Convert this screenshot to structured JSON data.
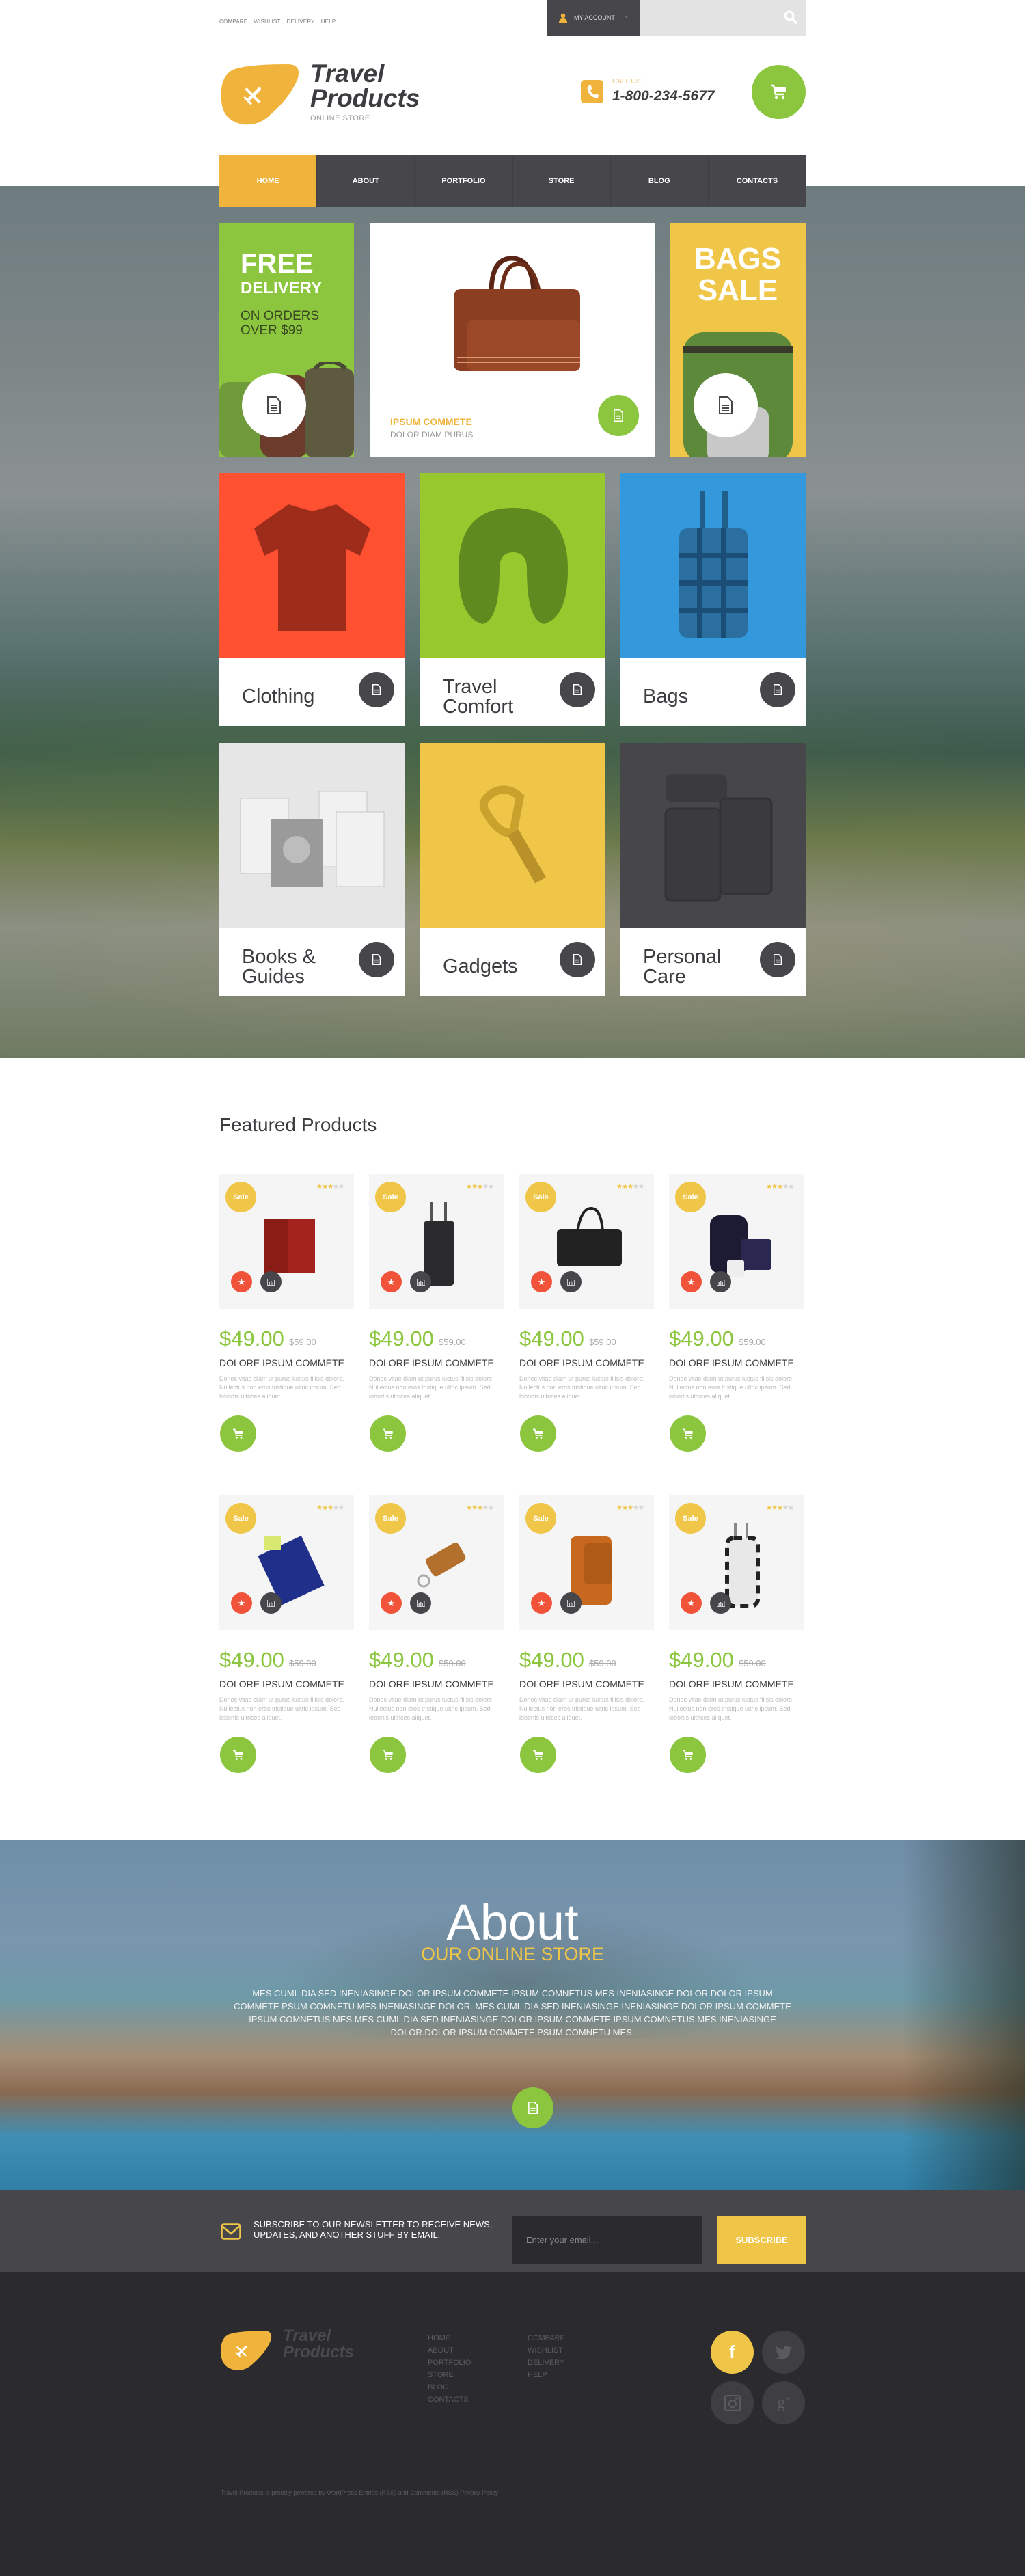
{
  "top_links": [
    "COMPARE",
    "WISHLIST",
    "DELIVERY",
    "HELP"
  ],
  "account": {
    "label": "MY ACCOUNT",
    "icon": "user-icon"
  },
  "search": {
    "placeholder": "",
    "icon": "search-icon"
  },
  "logo": {
    "line1": "Travel",
    "line2": "Products",
    "subtitle": "ONLINE STORE",
    "icon": "airplane-icon"
  },
  "contact": {
    "label": "CALL US:",
    "phone": "1-800-234-5677",
    "icon": "phone-icon"
  },
  "cart": {
    "icon": "cart-icon"
  },
  "nav": [
    {
      "label": "HOME",
      "active": true
    },
    {
      "label": "ABOUT"
    },
    {
      "label": "PORTFOLIO"
    },
    {
      "label": "STORE"
    },
    {
      "label": "BLOG"
    },
    {
      "label": "CONTACTS"
    }
  ],
  "promos": {
    "free_delivery": {
      "line1": "FREE",
      "line2": "DELIVERY",
      "line3": "ON ORDERS OVER $99"
    },
    "featured": {
      "title": "IPSUM COMMETE",
      "subtitle": "DOLOR DIAM PURUS"
    },
    "bags_sale": {
      "line1": "BAGS",
      "line2": "SALE"
    }
  },
  "categories": [
    {
      "label": "Clothing",
      "color": "#ff5132"
    },
    {
      "label": "Travel Comfort",
      "color": "#97c92e"
    },
    {
      "label": "Bags",
      "color": "#3498dc"
    },
    {
      "label": "Books & Guides",
      "color": "#e6e6e6"
    },
    {
      "label": "Gadgets",
      "color": "#f0c648"
    },
    {
      "label": "Personal Care",
      "color": "#47464b"
    }
  ],
  "featured": {
    "title": "Featured Products",
    "products": [
      {
        "badge": "Sale",
        "rating": 3,
        "price": "$49.00",
        "old_price": "$59.00",
        "name": "DOLORE IPSUM COMMETE",
        "desc": "Donec vitae diam ut purus luctus filisis dolore. Nullectus non eros tristique ultric ipsum. Sed lobortis ultrices aliquet.",
        "item": "red wallet"
      },
      {
        "badge": "Sale",
        "rating": 3,
        "price": "$49.00",
        "old_price": "$59.00",
        "name": "DOLORE IPSUM COMMETE",
        "desc": "Donec vitae diam ut purus luctus filisis dolore. Nullectus non eros tristique ultric ipsum. Sed lobortis ultrices aliquet.",
        "item": "black rolling suitcase"
      },
      {
        "badge": "Sale",
        "rating": 3,
        "price": "$49.00",
        "old_price": "$59.00",
        "name": "DOLORE IPSUM COMMETE",
        "desc": "Donec vitae diam ut purus luctus filisis dolore. Nullectus non eros tristique ultric ipsum. Sed lobortis ultrices aliquet.",
        "item": "black travel bag"
      },
      {
        "badge": "Sale",
        "rating": 3,
        "price": "$49.00",
        "old_price": "$59.00",
        "name": "DOLORE IPSUM COMMETE",
        "desc": "Donec vitae diam ut purus luctus filisis dolore. Nullectus non eros tristique ultric ipsum. Sed lobortis ultrices aliquet.",
        "item": "backpack set"
      },
      {
        "badge": "Sale",
        "rating": 3,
        "price": "$49.00",
        "old_price": "$59.00",
        "name": "DOLORE IPSUM COMMETE",
        "desc": "Donec vitae diam ut purus luctus filisis dolore. Nullectus non eros tristique ultric ipsum. Sed lobortis ultrices aliquet.",
        "item": "blue travel organizer"
      },
      {
        "badge": "Sale",
        "rating": 3,
        "price": "$49.00",
        "old_price": "$59.00",
        "name": "DOLORE IPSUM COMMETE",
        "desc": "Donec vitae diam ut purus luctus filisis dolore. Nullectus non eros tristique ultric ipsum. Sed lobortis ultrices aliquet.",
        "item": "key holder"
      },
      {
        "badge": "Sale",
        "rating": 3,
        "price": "$49.00",
        "old_price": "$59.00",
        "name": "DOLORE IPSUM COMMETE",
        "desc": "Donec vitae diam ut purus luctus filisis dolore. Nullectus non eros tristique ultric ipsum. Sed lobortis ultrices aliquet.",
        "item": "orange leather suitcase"
      },
      {
        "badge": "Sale",
        "rating": 3,
        "price": "$49.00",
        "old_price": "$59.00",
        "name": "DOLORE IPSUM COMMETE",
        "desc": "Donec vitae diam ut purus luctus filisis dolore. Nullectus non eros tristique ultric ipsum. Sed lobortis ultrices aliquet.",
        "item": "plaid rolling bag"
      }
    ]
  },
  "about": {
    "title": "About",
    "subtitle": "OUR ONLINE STORE",
    "text": "MES CUML DIA SED INENIASINGE DOLOR IPSUM COMMETE IPSUM COMNETUS MES INENIASINGE DOLOR.DOLOR IPSUM COMMETE PSUM COMNETU MES INENIASINGE DOLOR. MES CUML DIA SED INENIASINGE INENIASINGE DOLOR IPSUM COMMETE IPSUM COMNETUS MES.MES CUML DIA SED INENIASINGE DOLOR IPSUM COMMETE IPSUM COMNETUS MES INENIASINGE DOLOR.DOLOR IPSUM COMMETE PSUM COMNETU MES."
  },
  "newsletter": {
    "message": "SUBSCRIBE TO OUR NEWSLETTER TO RECEIVE NEWS, UPDATES, AND ANOTHER STUFF BY EMAIL.",
    "placeholder": "Enter your email...",
    "button": "SUBSCRIBE"
  },
  "footer": {
    "logo_line1": "Travel",
    "logo_line2": "Products",
    "col1": [
      "HOME",
      "ABOUT",
      "PORTFOLIO",
      "STORE",
      "BLOG",
      "CONTACTS"
    ],
    "col2": [
      "COMPARE",
      "WISHLIST",
      "DELIVERY",
      "HELP"
    ],
    "social": [
      "facebook",
      "twitter",
      "instagram",
      "google-plus"
    ],
    "copyright": "Travel Products is proudly powered by WordPress Entries (RSS) and Comments (RSS) Privacy Policy"
  },
  "colors": {
    "accent_orange": "#f0b43c",
    "accent_green": "#8cc63f",
    "accent_yellow": "#f0c648",
    "dark": "#47464b",
    "red": "#f0533a"
  }
}
